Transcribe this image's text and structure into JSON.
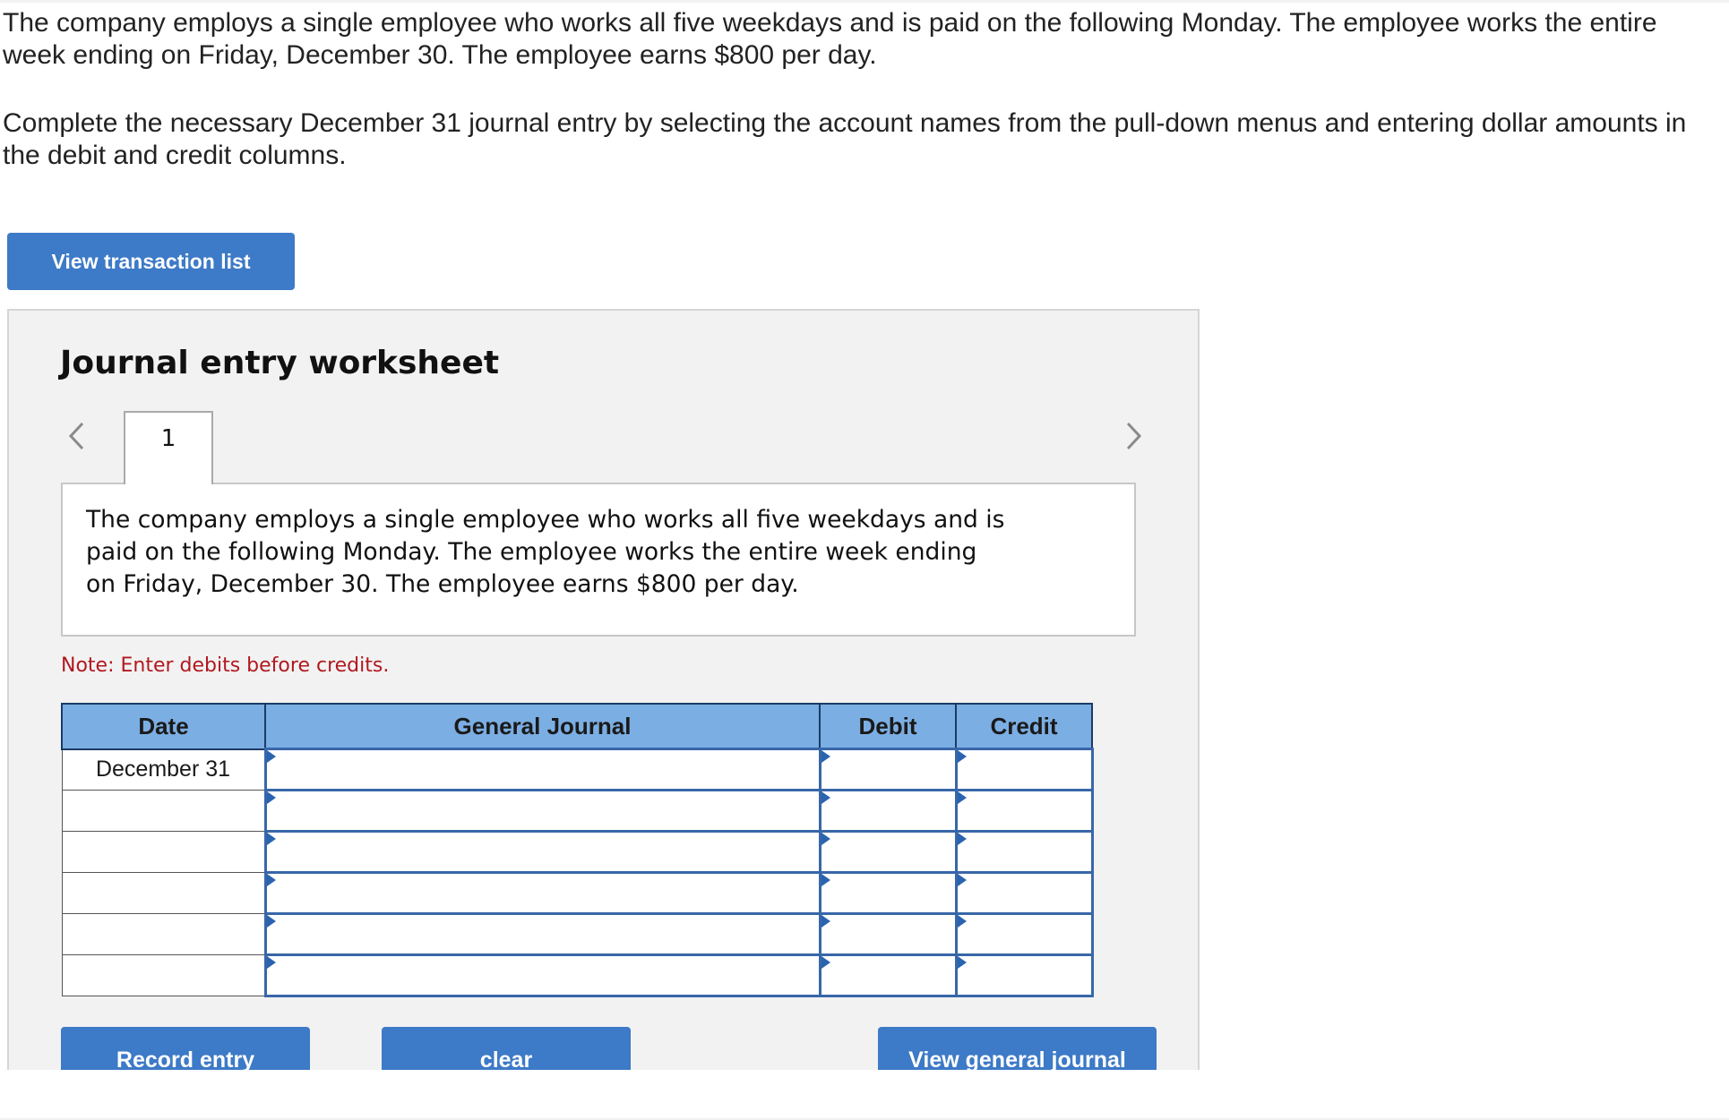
{
  "intro": "The company employs a single employee who works all five weekdays and is paid on the following Monday. The employee works the entire week ending on Friday, December 30. The employee earns $800 per day.",
  "instructions": "Complete the necessary December 31 journal entry by selecting the account names from the pull-down menus and entering dollar amounts in the debit and credit columns.",
  "view_transaction_list_label": "View transaction list",
  "worksheet": {
    "title": "Journal entry worksheet",
    "prev_icon": "chevron-left-icon",
    "next_icon": "chevron-right-icon",
    "active_tab": "1",
    "scenario": "The company employs a single employee who works all five weekdays and is paid on the following Monday. The employee works the entire week ending on Friday, December 30. The employee earns $800 per day.",
    "note": "Note: Enter debits before credits.",
    "table": {
      "headers": {
        "date": "Date",
        "general_journal": "General Journal",
        "debit": "Debit",
        "credit": "Credit"
      },
      "rows": [
        {
          "date": "December 31",
          "account": "",
          "debit": "",
          "credit": ""
        },
        {
          "date": "",
          "account": "",
          "debit": "",
          "credit": ""
        },
        {
          "date": "",
          "account": "",
          "debit": "",
          "credit": ""
        },
        {
          "date": "",
          "account": "",
          "debit": "",
          "credit": ""
        },
        {
          "date": "",
          "account": "",
          "debit": "",
          "credit": ""
        },
        {
          "date": "",
          "account": "",
          "debit": "",
          "credit": ""
        }
      ]
    },
    "buttons": {
      "record_entry": "Record entry",
      "clear": "clear",
      "view_general_journal": "View general journal"
    }
  },
  "colors": {
    "accent_button": "#3d7ac7",
    "table_header": "#7baee3",
    "input_border": "#3867a8",
    "note_red": "#b1181f",
    "panel_bg": "#f2f2f2"
  }
}
